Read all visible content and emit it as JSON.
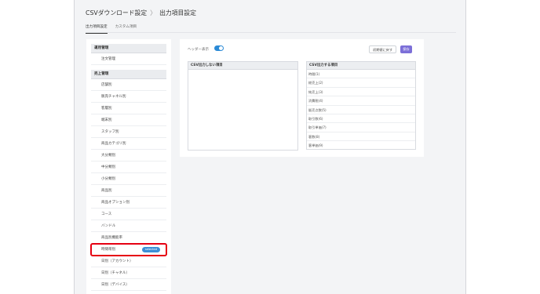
{
  "header": {
    "breadcrumb_parent": "CSVダウンロード設定",
    "breadcrumb_separator": "〉",
    "breadcrumb_current": "出力項目設定"
  },
  "tabs": [
    {
      "label": "出力項目設定",
      "active": true
    },
    {
      "label": "カスタム項目",
      "active": false
    }
  ],
  "sidebar": {
    "group1": {
      "title": "運用管理",
      "items": [
        "注文管理"
      ]
    },
    "group2": {
      "title": "売上管理",
      "items": [
        "店舗別",
        "販売チャネル別",
        "客層別",
        "端末別",
        "スタッフ別",
        "商品カテゴリ別",
        "大分類別",
        "中分類別",
        "小分類別",
        "商品別",
        "商品オプション別",
        "コース",
        "バンドル",
        "商品別機能率",
        "時間帯別",
        "日別（アカウント）",
        "日別（チャネル）",
        "日別（デバイス）"
      ],
      "selected_badge": "selected"
    }
  },
  "toolbar": {
    "header_display_label": "ヘッダー表示",
    "header_display_on": true,
    "reset_label": "初期値に戻す",
    "save_label": "保存"
  },
  "columns": {
    "left_title": "CSV出力しない項目",
    "right_title": "CSV出力する項目",
    "right_items": [
      "時間(1)",
      "総売上(2)",
      "純売上(3)",
      "消費税(4)",
      "販売点数(5)",
      "取引数(6)",
      "取引単価(7)",
      "客数(8)",
      "客単価(9)"
    ]
  },
  "colors": {
    "accent_purple": "#7c6fd8",
    "toggle_blue": "#2b8ad6",
    "highlight_red": "#e60012",
    "badge_blue": "#3d8fd6"
  }
}
